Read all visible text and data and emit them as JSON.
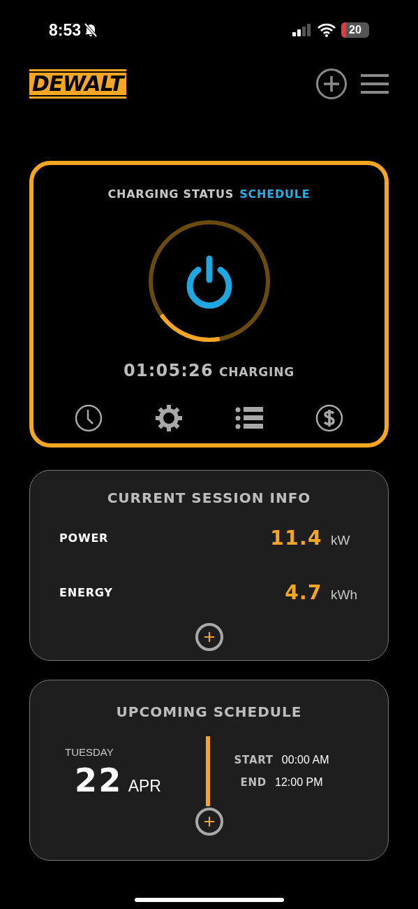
{
  "status_bar": {
    "time": "8:53",
    "battery": "20"
  },
  "header": {
    "logo": "DEWALT"
  },
  "charging_card": {
    "title": "CHARGING STATUS",
    "title_accent": "SCHEDULE",
    "timer": "01:05:26",
    "state": "CHARGING",
    "actions": [
      {
        "kind": "clock"
      },
      {
        "kind": "gear"
      },
      {
        "kind": "list"
      },
      {
        "kind": "dollar"
      }
    ]
  },
  "session_card": {
    "title": "CURRENT SESSION INFO",
    "rows": [
      {
        "label": "POWER",
        "value": "11.4",
        "unit": "kW"
      },
      {
        "label": "ENERGY",
        "value": "4.7",
        "unit": "kWh"
      }
    ]
  },
  "schedule_card": {
    "title": "UPCOMING SCHEDULE",
    "weekday": "TUESDAY",
    "day": "22",
    "month": "APR",
    "times": [
      {
        "label": "START",
        "value": "00:00 AM"
      },
      {
        "label": "END",
        "value": "12:00 PM"
      }
    ]
  }
}
